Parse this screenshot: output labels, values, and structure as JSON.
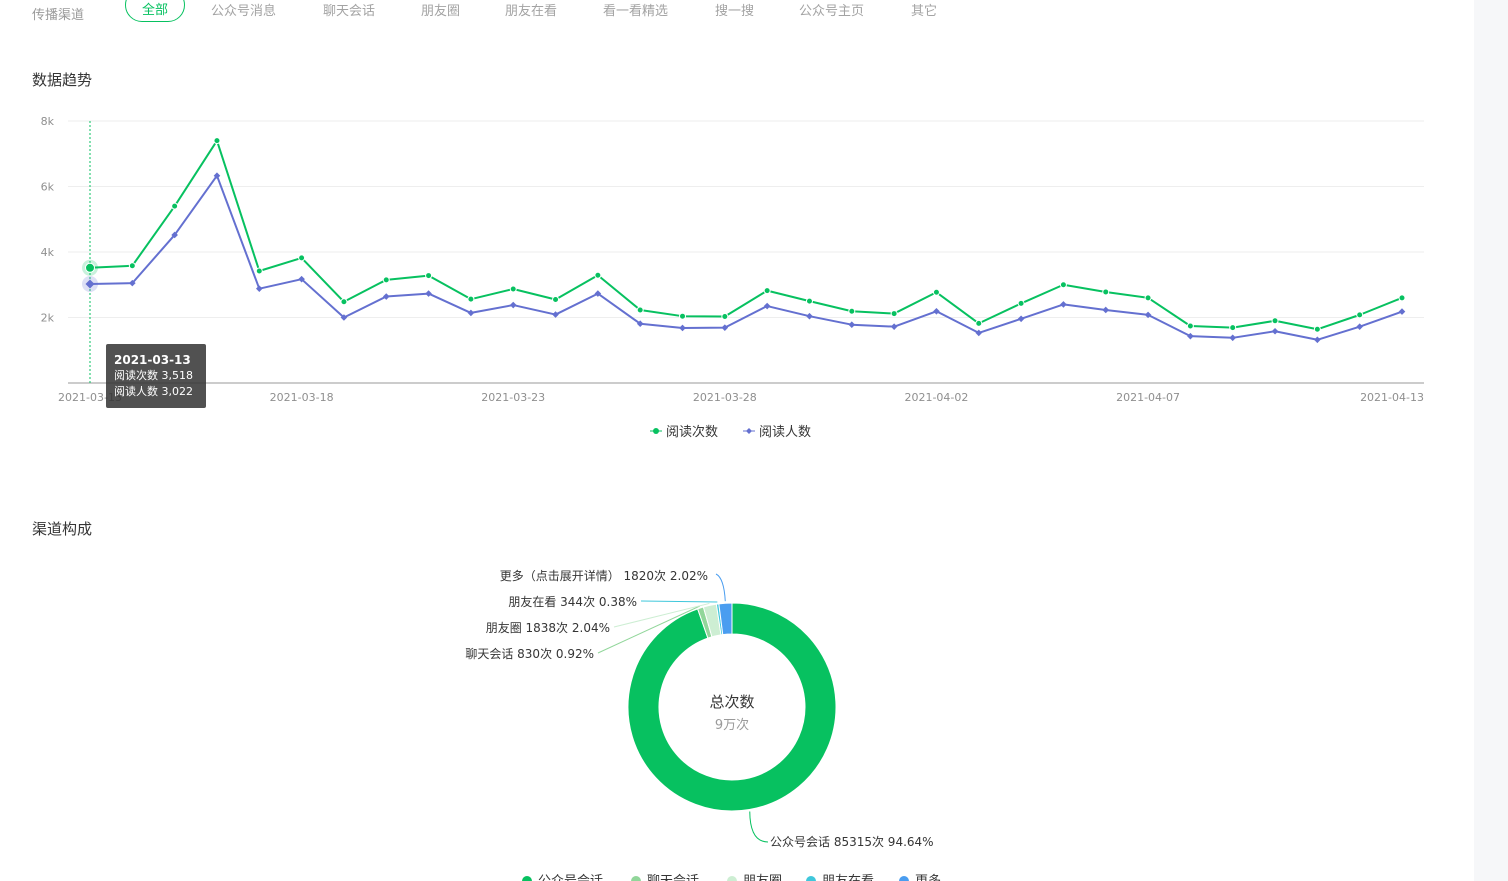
{
  "filter": {
    "label": "传播渠道",
    "tabs": [
      {
        "label": "全部",
        "active": true
      },
      {
        "label": "公众号消息",
        "active": false
      },
      {
        "label": "聊天会话",
        "active": false
      },
      {
        "label": "朋友圈",
        "active": false
      },
      {
        "label": "朋友在看",
        "active": false
      },
      {
        "label": "看一看精选",
        "active": false
      },
      {
        "label": "搜一搜",
        "active": false
      },
      {
        "label": "公众号主页",
        "active": false
      },
      {
        "label": "其它",
        "active": false
      }
    ]
  },
  "trend": {
    "title": "数据趋势",
    "tooltip": {
      "date": "2021-03-13",
      "line1": "阅读次数 3,518",
      "line2": "阅读人数 3,022"
    }
  },
  "channel": {
    "title": "渠道构成",
    "center_label": "总次数",
    "center_value": "9万次"
  },
  "colors": {
    "green": "#07c160",
    "purple": "#6470d0",
    "light_green": "#91d69a",
    "pale_green": "#cdeed3",
    "cyan": "#3fc7db",
    "blue": "#4a9df0"
  },
  "chart_data": [
    {
      "type": "line",
      "x": [
        "2021-03-13",
        "2021-03-14",
        "2021-03-15",
        "2021-03-16",
        "2021-03-17",
        "2021-03-18",
        "2021-03-19",
        "2021-03-20",
        "2021-03-21",
        "2021-03-22",
        "2021-03-23",
        "2021-03-24",
        "2021-03-25",
        "2021-03-26",
        "2021-03-27",
        "2021-03-28",
        "2021-03-29",
        "2021-03-30",
        "2021-03-31",
        "2021-04-01",
        "2021-04-02",
        "2021-04-03",
        "2021-04-04",
        "2021-04-05",
        "2021-04-06",
        "2021-04-07",
        "2021-04-08",
        "2021-04-09",
        "2021-04-10",
        "2021-04-11",
        "2021-04-12",
        "2021-04-13"
      ],
      "xtick_labels": [
        "2021-03-13",
        "2021-03-18",
        "2021-03-23",
        "2021-03-28",
        "2021-04-02",
        "2021-04-07",
        "2021-04-13"
      ],
      "series": [
        {
          "name": "阅读次数",
          "color": "#07c160",
          "values": [
            3518,
            3580,
            5400,
            7400,
            3420,
            3820,
            2480,
            3150,
            3280,
            2560,
            2870,
            2550,
            3290,
            2230,
            2040,
            2030,
            2820,
            2500,
            2190,
            2120,
            2770,
            1820,
            2430,
            3000,
            2780,
            2600,
            1740,
            1690,
            1900,
            1640,
            2080,
            2600
          ]
        },
        {
          "name": "阅读人数",
          "color": "#6470d0",
          "values": [
            3022,
            3050,
            4520,
            6330,
            2880,
            3170,
            2000,
            2640,
            2730,
            2140,
            2380,
            2090,
            2730,
            1810,
            1680,
            1690,
            2350,
            2040,
            1780,
            1720,
            2190,
            1530,
            1960,
            2400,
            2230,
            2080,
            1430,
            1380,
            1580,
            1320,
            1720,
            2180
          ]
        }
      ],
      "ylim": [
        0,
        8000
      ],
      "yticks": [
        "2k",
        "4k",
        "6k",
        "8k"
      ],
      "grid": true,
      "legend_position": "bottom"
    },
    {
      "type": "pie",
      "slices": [
        {
          "name": "公众号会话",
          "value": 85315,
          "percent": "94.64%",
          "label": "公众号会话 85315次 94.64%",
          "color": "#07c160"
        },
        {
          "name": "聊天会话",
          "value": 830,
          "percent": "0.92%",
          "label": "聊天会话 830次 0.92%",
          "color": "#91d69a"
        },
        {
          "name": "朋友圈",
          "value": 1838,
          "percent": "2.04%",
          "label": "朋友圈 1838次 2.04%",
          "color": "#cdeed3"
        },
        {
          "name": "朋友在看",
          "value": 344,
          "percent": "0.38%",
          "label": "朋友在看 344次 0.38%",
          "color": "#3fc7db"
        },
        {
          "name": "更多",
          "value": 1820,
          "percent": "2.02%",
          "label": "更多（点击展开详情） 1820次 2.02%",
          "color": "#4a9df0"
        }
      ],
      "legend": [
        "公众号会话",
        "聊天会话",
        "朋友圈",
        "朋友在看",
        "更多"
      ],
      "legend_position": "bottom"
    }
  ]
}
